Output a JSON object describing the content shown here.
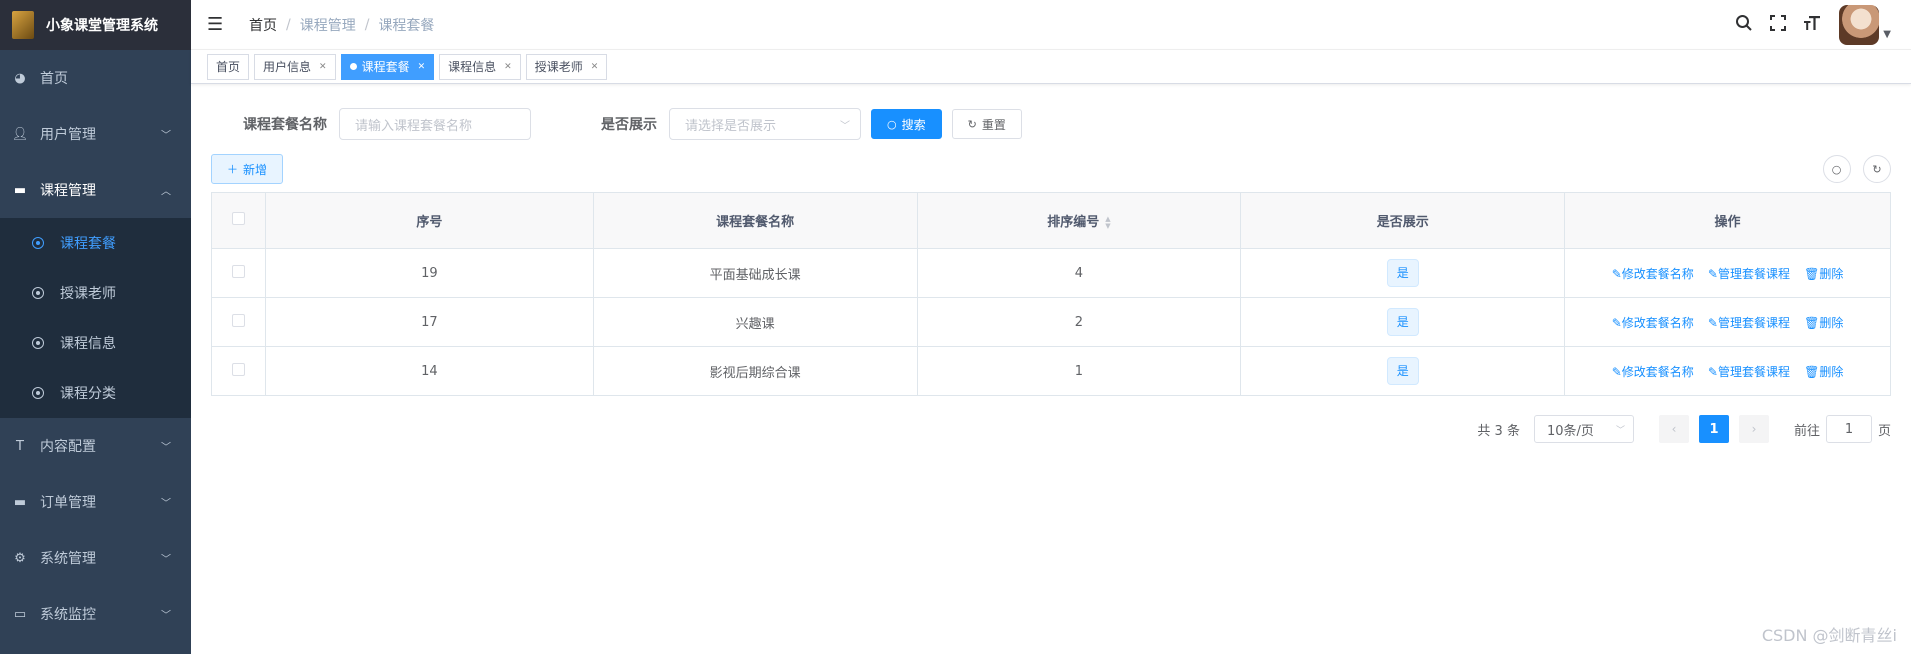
{
  "app": {
    "title": "小象课堂管理系统"
  },
  "sidebar": {
    "items": [
      {
        "label": "首页",
        "icon": "dashboard-icon"
      },
      {
        "label": "用户管理",
        "icon": "user-icon"
      },
      {
        "label": "课程管理",
        "icon": "clapper-icon",
        "open": true,
        "children": [
          {
            "label": "课程套餐",
            "active": true
          },
          {
            "label": "授课老师"
          },
          {
            "label": "课程信息"
          },
          {
            "label": "课程分类"
          }
        ]
      },
      {
        "label": "内容配置",
        "icon": "text-size-icon"
      },
      {
        "label": "订单管理",
        "icon": "clapper-icon"
      },
      {
        "label": "系统管理",
        "icon": "gear-icon"
      },
      {
        "label": "系统监控",
        "icon": "monitor-icon"
      }
    ]
  },
  "navbar": {
    "breadcrumb": [
      "首页",
      "课程管理",
      "课程套餐"
    ],
    "separator": "/"
  },
  "tags": [
    {
      "label": "首页",
      "closable": false,
      "active": false
    },
    {
      "label": "用户信息",
      "closable": true,
      "active": false
    },
    {
      "label": "课程套餐",
      "closable": true,
      "active": true
    },
    {
      "label": "课程信息",
      "closable": true,
      "active": false
    },
    {
      "label": "授课老师",
      "closable": true,
      "active": false
    }
  ],
  "search": {
    "name_label": "课程套餐名称",
    "name_placeholder": "请输入课程套餐名称",
    "show_label": "是否展示",
    "show_placeholder": "请选择是否展示",
    "search_button": "搜索",
    "reset_button": "重置"
  },
  "toolbar": {
    "add_button": "新增"
  },
  "table": {
    "columns": [
      "序号",
      "课程套餐名称",
      "排序编号",
      "是否展示",
      "操作"
    ],
    "rows": [
      {
        "id": "19",
        "name": "平面基础成长课",
        "sort": "4",
        "show": "是"
      },
      {
        "id": "17",
        "name": "兴趣课",
        "sort": "2",
        "show": "是"
      },
      {
        "id": "14",
        "name": "影视后期综合课",
        "sort": "1",
        "show": "是"
      }
    ],
    "actions": {
      "edit": "修改套餐名称",
      "manage": "管理套餐课程",
      "delete": "删除"
    }
  },
  "pagination": {
    "total_text": "共 3 条",
    "page_size": "10条/页",
    "current_page": "1",
    "goto_prefix": "前往",
    "goto_value": "1",
    "goto_suffix": "页"
  },
  "watermark": "CSDN @剑断青丝i",
  "colors": {
    "sidebar_bg": "#304156",
    "primary": "#1890ff",
    "active_tag": "#409eff"
  }
}
